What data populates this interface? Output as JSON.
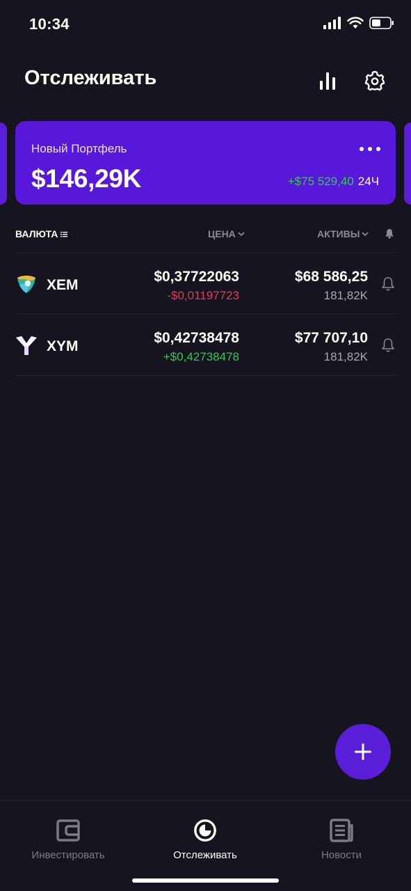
{
  "status_bar": {
    "time": "10:34"
  },
  "header": {
    "title": "Отслеживать"
  },
  "portfolio": {
    "name": "Новый Портфель",
    "value": "$146,29K",
    "change": "+$75 529,40",
    "period": "24Ч"
  },
  "table": {
    "columns": {
      "currency": "ВАЛЮТА",
      "price": "ЦЕНА",
      "holdings": "АКТИВЫ"
    },
    "rows": [
      {
        "symbol": "XEM",
        "price": "$0,37722063",
        "change": "-$0,01197723",
        "holdings_value": "$68 586,25",
        "holdings_amount": "181,82K"
      },
      {
        "symbol": "XYM",
        "price": "$0,42738478",
        "change": "+$0,42738478",
        "holdings_value": "$77 707,10",
        "holdings_amount": "181,82K"
      }
    ]
  },
  "tabs": [
    {
      "label": "Инвестировать",
      "icon": "wallet-icon"
    },
    {
      "label": "Отслеживать",
      "icon": "pie-chart-icon"
    },
    {
      "label": "Новости",
      "icon": "news-icon"
    }
  ],
  "colors": {
    "accent": "#5718d9",
    "background": "#15141f",
    "positive": "#2ecc4f",
    "negative": "#e8385a"
  }
}
